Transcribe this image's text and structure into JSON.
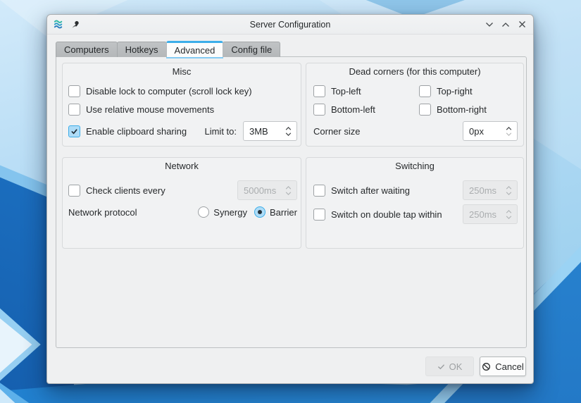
{
  "titlebar": {
    "title": "Server Configuration",
    "app_icon": "barrier-waves-icon",
    "pin_icon": "pin-icon",
    "minimize_icon": "chevron-down-icon",
    "maximize_icon": "chevron-up-icon",
    "close_icon": "close-x-icon"
  },
  "tabs": [
    {
      "label": "Computers",
      "active": false
    },
    {
      "label": "Hotkeys",
      "active": false
    },
    {
      "label": "Advanced",
      "active": true
    },
    {
      "label": "Config file",
      "active": false
    }
  ],
  "misc": {
    "title": "Misc",
    "cb_disable_lock": {
      "label": "Disable lock to computer (scroll lock key)",
      "checked": false
    },
    "cb_relative_mouse": {
      "label": "Use relative mouse movements",
      "checked": false
    },
    "cb_clipboard": {
      "label": "Enable clipboard sharing",
      "checked": true
    },
    "limit_label": "Limit to:",
    "limit_value": "3MB"
  },
  "dead_corners": {
    "title": "Dead corners (for this computer)",
    "cb_top_left": {
      "label": "Top-left",
      "checked": false
    },
    "cb_top_right": {
      "label": "Top-right",
      "checked": false
    },
    "cb_bottom_left": {
      "label": "Bottom-left",
      "checked": false
    },
    "cb_bottom_right": {
      "label": "Bottom-right",
      "checked": false
    },
    "corner_size_label": "Corner size",
    "corner_size_value": "0px"
  },
  "network": {
    "title": "Network",
    "cb_check_clients": {
      "label": "Check clients every",
      "checked": false
    },
    "check_interval_value": "5000ms",
    "check_interval_enabled": false,
    "protocol_label": "Network protocol",
    "radio_synergy": {
      "label": "Synergy",
      "selected": false
    },
    "radio_barrier": {
      "label": "Barrier",
      "selected": true
    }
  },
  "switching": {
    "title": "Switching",
    "cb_switch_wait": {
      "label": "Switch after waiting",
      "checked": false
    },
    "switch_wait_value": "250ms",
    "switch_wait_enabled": false,
    "cb_double_tap": {
      "label": "Switch on double tap within",
      "checked": false
    },
    "double_tap_value": "250ms",
    "double_tap_enabled": false
  },
  "footer": {
    "ok_label": "OK",
    "ok_enabled": false,
    "ok_icon": "check-icon",
    "cancel_label": "Cancel",
    "cancel_icon": "prohibition-icon"
  },
  "colors": {
    "accent": "#3daee9",
    "window_bg": "#eff0f1",
    "text": "#26292b",
    "disabled_text": "#aaadaf",
    "checked_fill": "#aedcf7",
    "wallpaper_dark_blue": "#1c70c1",
    "wallpaper_light_blue": "#b6dcf5"
  }
}
